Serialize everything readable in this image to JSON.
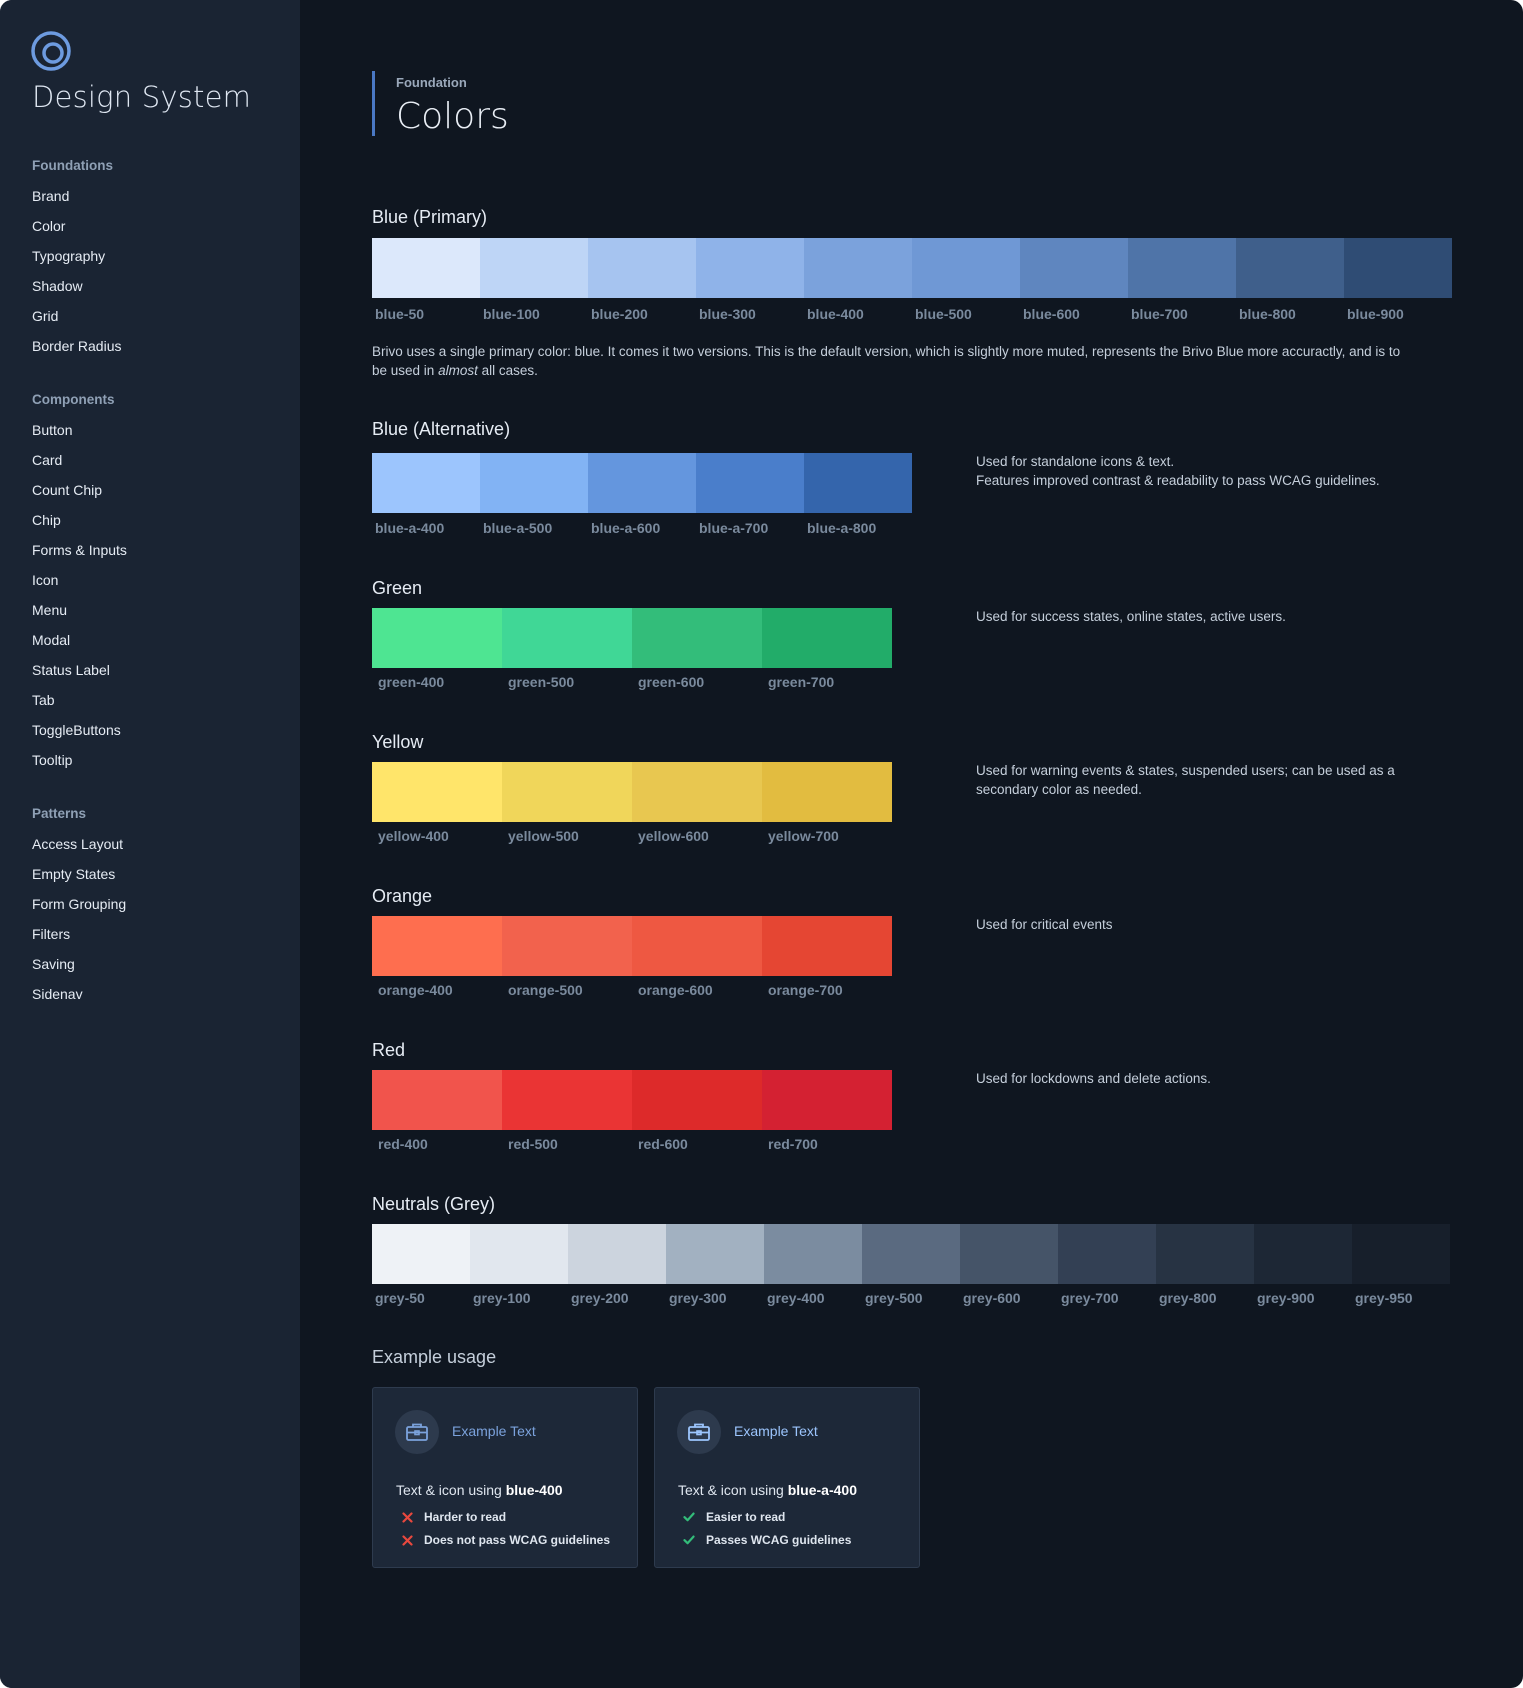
{
  "app": {
    "title": "Design System"
  },
  "sidebar": {
    "sections": [
      {
        "heading": "Foundations",
        "items": [
          "Brand",
          "Color",
          "Typography",
          "Shadow",
          "Grid",
          "Border Radius"
        ]
      },
      {
        "heading": "Components",
        "items": [
          "Button",
          "Card",
          "Count Chip",
          "Chip",
          "Forms & Inputs",
          "Icon",
          "Menu",
          "Modal",
          "Status Label",
          "Tab",
          "ToggleButtons",
          "Tooltip"
        ]
      },
      {
        "heading": "Patterns",
        "items": [
          "Access Layout",
          "Empty States",
          "Form Grouping",
          "Filters",
          "Saving",
          "Sidenav"
        ]
      }
    ]
  },
  "header": {
    "eyebrow": "Foundation",
    "title": "Colors"
  },
  "palettes": {
    "blue": {
      "title": "Blue (Primary)",
      "swatches": [
        {
          "name": "blue-50",
          "color": "#dce8fb"
        },
        {
          "name": "blue-100",
          "color": "#bed5f6"
        },
        {
          "name": "blue-200",
          "color": "#a6c4f0"
        },
        {
          "name": "blue-300",
          "color": "#8fb3e9"
        },
        {
          "name": "blue-400",
          "color": "#7ba2dc"
        },
        {
          "name": "blue-500",
          "color": "#6f98d5"
        },
        {
          "name": "blue-600",
          "color": "#5f86bf"
        },
        {
          "name": "blue-700",
          "color": "#4f74a8"
        },
        {
          "name": "blue-800",
          "color": "#3f5f8b"
        },
        {
          "name": "blue-900",
          "color": "#2f4c74"
        }
      ],
      "desc_before": "Brivo uses a single primary color: blue. It comes it two versions. This is the default version, which is slightly more muted, represents the Brivo Blue more accuractly, and is to be used in ",
      "desc_em": "almost",
      "desc_after": " all cases."
    },
    "blue_alt": {
      "title": "Blue (Alternative)",
      "swatches": [
        {
          "name": "blue-a-400",
          "color": "#9cc5fd"
        },
        {
          "name": "blue-a-500",
          "color": "#82b3f4"
        },
        {
          "name": "blue-a-600",
          "color": "#6496de"
        },
        {
          "name": "blue-a-700",
          "color": "#4a7ecb"
        },
        {
          "name": "blue-a-800",
          "color": "#3465ac"
        }
      ],
      "desc_line1": "Used for standalone icons & text.",
      "desc_line2": "Features improved contrast & readability to pass WCAG guidelines."
    },
    "green": {
      "title": "Green",
      "swatches": [
        {
          "name": "green-400",
          "color": "#4ee592"
        },
        {
          "name": "green-500",
          "color": "#40d796"
        },
        {
          "name": "green-600",
          "color": "#33bd7a"
        },
        {
          "name": "green-700",
          "color": "#22ac69"
        }
      ],
      "desc": "Used for success states, online states, active users."
    },
    "yellow": {
      "title": "Yellow",
      "swatches": [
        {
          "name": "yellow-400",
          "color": "#ffe56a"
        },
        {
          "name": "yellow-500",
          "color": "#f0d65a"
        },
        {
          "name": "yellow-600",
          "color": "#e8c750"
        },
        {
          "name": "yellow-700",
          "color": "#e2bc40"
        }
      ],
      "desc": "Used for warning events & states, suspended users; can be used as a secondary color as needed."
    },
    "orange": {
      "title": "Orange",
      "swatches": [
        {
          "name": "orange-400",
          "color": "#fe6e4f"
        },
        {
          "name": "orange-500",
          "color": "#f2624d"
        },
        {
          "name": "orange-600",
          "color": "#ee5842"
        },
        {
          "name": "orange-700",
          "color": "#e54633"
        }
      ],
      "desc": "Used for critical events"
    },
    "red": {
      "title": "Red",
      "swatches": [
        {
          "name": "red-400",
          "color": "#f1544c"
        },
        {
          "name": "red-500",
          "color": "#ea3434"
        },
        {
          "name": "red-600",
          "color": "#dd2a2a"
        },
        {
          "name": "red-700",
          "color": "#d42132"
        }
      ],
      "desc": "Used for lockdowns and delete actions."
    },
    "grey": {
      "title": "Neutrals (Grey)",
      "swatches": [
        {
          "name": "grey-50",
          "color": "#eef2f6"
        },
        {
          "name": "grey-100",
          "color": "#e1e7ee"
        },
        {
          "name": "grey-200",
          "color": "#ccd4de"
        },
        {
          "name": "grey-300",
          "color": "#a2b1c1"
        },
        {
          "name": "grey-400",
          "color": "#7b8ca0"
        },
        {
          "name": "grey-500",
          "color": "#5a6a80"
        },
        {
          "name": "grey-600",
          "color": "#455468"
        },
        {
          "name": "grey-700",
          "color": "#334054"
        },
        {
          "name": "grey-800",
          "color": "#273343"
        },
        {
          "name": "grey-900",
          "color": "#1d2735"
        },
        {
          "name": "grey-950",
          "color": "#171f2b"
        }
      ]
    }
  },
  "example": {
    "title": "Example usage",
    "cards": [
      {
        "label": "Example Text",
        "accent": "#7ba2dc",
        "text_prefix": "Text & icon using ",
        "text_token": "blue-400",
        "status": "fail",
        "status_color": "#e8483e",
        "points": [
          "Harder to read",
          "Does not pass WCAG guidelines"
        ],
        "icon": "briefcase-icon"
      },
      {
        "label": "Example Text",
        "accent": "#9cc5fd",
        "text_prefix": "Text & icon using ",
        "text_token": "blue-a-400",
        "status": "pass",
        "status_color": "#33bd7a",
        "points": [
          "Easier to read",
          "Passes WCAG guidelines"
        ],
        "icon": "briefcase-icon"
      }
    ]
  }
}
